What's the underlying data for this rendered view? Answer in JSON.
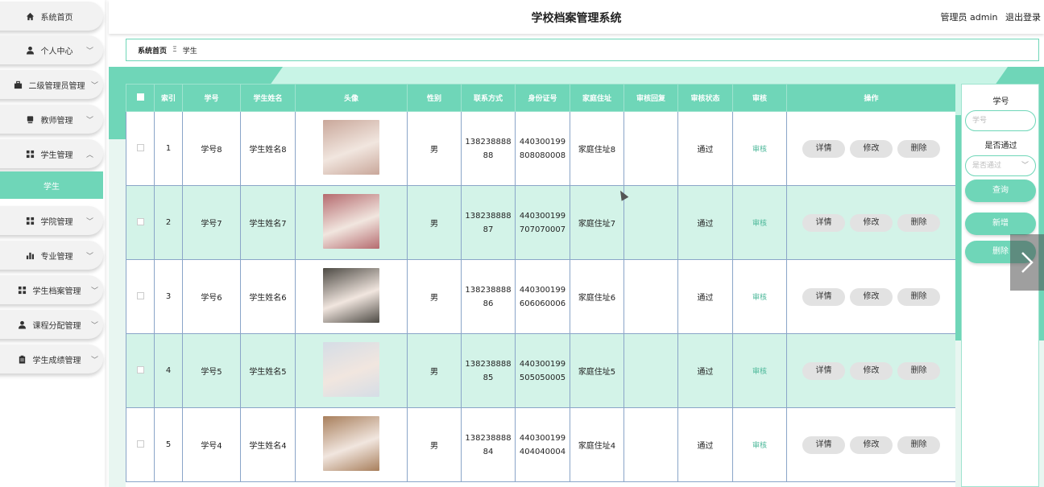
{
  "header": {
    "title": "学校档案管理系统",
    "user_label": "管理员 admin",
    "logout_label": "退出登录"
  },
  "sidebar": {
    "items": [
      {
        "label": "系统首页",
        "icon": "home-icon",
        "chevron": ""
      },
      {
        "label": "个人中心",
        "icon": "user-icon",
        "chevron": "﹀"
      },
      {
        "label": "二级管理员管理",
        "icon": "briefcase-icon",
        "chevron": "﹀"
      },
      {
        "label": "教师管理",
        "icon": "device-icon",
        "chevron": "﹀"
      },
      {
        "label": "学生管理",
        "icon": "grid-icon",
        "chevron": "︿"
      },
      {
        "label": "学院管理",
        "icon": "grid-icon",
        "chevron": "﹀"
      },
      {
        "label": "专业管理",
        "icon": "bar-chart-icon",
        "chevron": "﹀"
      },
      {
        "label": "学生档案管理",
        "icon": "grid-icon",
        "chevron": "﹀"
      },
      {
        "label": "课程分配管理",
        "icon": "user-icon",
        "chevron": "﹀"
      },
      {
        "label": "学生成绩管理",
        "icon": "clipboard-icon",
        "chevron": "﹀"
      }
    ],
    "active_sub": "学生"
  },
  "breadcrumb": {
    "home": "系统首页",
    "separator": "Ξ",
    "current": "学生"
  },
  "table": {
    "columns": [
      "索引",
      "学号",
      "学生姓名",
      "头像",
      "性别",
      "联系方式",
      "身份证号",
      "家庭住址",
      "审核回复",
      "审核状态",
      "审核",
      "操作"
    ],
    "rows": [
      {
        "index": "1",
        "id": "学号8",
        "name": "学生姓名8",
        "gender": "男",
        "phone_a": "138238888",
        "phone_b": "88",
        "idcard_a": "440300199",
        "idcard_b": "808080008",
        "address": "家庭住址8",
        "reply": "",
        "status": "通过",
        "audit": "审核",
        "avatar_color": "#c9a79a"
      },
      {
        "index": "2",
        "id": "学号7",
        "name": "学生姓名7",
        "gender": "男",
        "phone_a": "138238888",
        "phone_b": "87",
        "idcard_a": "440300199",
        "idcard_b": "707070007",
        "address": "家庭住址7",
        "reply": "",
        "status": "通过",
        "audit": "审核",
        "avatar_color": "#b56b6f"
      },
      {
        "index": "3",
        "id": "学号6",
        "name": "学生姓名6",
        "gender": "男",
        "phone_a": "138238888",
        "phone_b": "86",
        "idcard_a": "440300199",
        "idcard_b": "606060006",
        "address": "家庭住址6",
        "reply": "",
        "status": "通过",
        "audit": "审核",
        "avatar_color": "#4d4a44"
      },
      {
        "index": "4",
        "id": "学号5",
        "name": "学生姓名5",
        "gender": "男",
        "phone_a": "138238888",
        "phone_b": "85",
        "idcard_a": "440300199",
        "idcard_b": "505050005",
        "address": "家庭住址5",
        "reply": "",
        "status": "通过",
        "audit": "审核",
        "avatar_color": "#d5dde6"
      },
      {
        "index": "5",
        "id": "学号4",
        "name": "学生姓名4",
        "gender": "男",
        "phone_a": "138238888",
        "phone_b": "84",
        "idcard_a": "440300199",
        "idcard_b": "404040004",
        "address": "家庭住址4",
        "reply": "",
        "status": "通过",
        "audit": "审核",
        "avatar_color": "#a87f5c"
      }
    ],
    "actions": {
      "detail": "详情",
      "edit": "修改",
      "delete": "删除"
    }
  },
  "search": {
    "id_label": "学号",
    "id_placeholder": "学号",
    "pass_label": "是否通过",
    "pass_placeholder": "是否通过",
    "query_button": "查询",
    "add_button": "新增",
    "delete_button": "删除"
  },
  "colors": {
    "accent": "#6fd6b8",
    "row_alt": "#d3f3e8"
  }
}
